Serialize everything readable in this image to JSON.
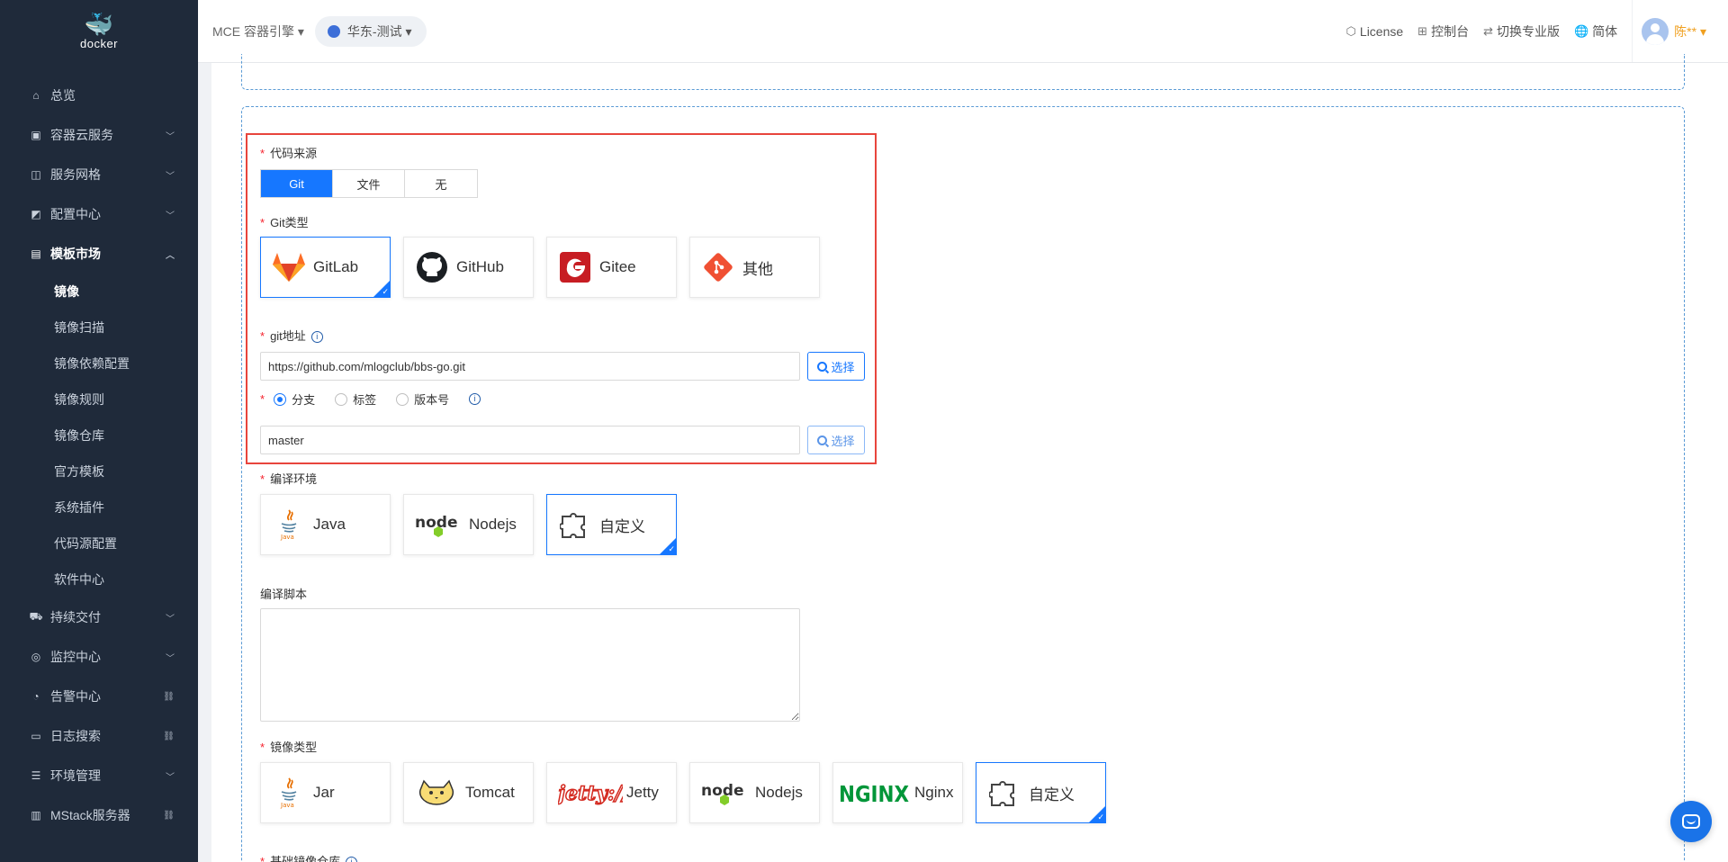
{
  "sidebar": {
    "logo_text": "docker",
    "items": [
      {
        "icon": "home-icon",
        "label": "总览",
        "arrow": ""
      },
      {
        "icon": "container-icon",
        "label": "容器云服务",
        "arrow": "⌄"
      },
      {
        "icon": "mesh-icon",
        "label": "服务网格",
        "arrow": "⌄"
      },
      {
        "icon": "config-icon",
        "label": "配置中心",
        "arrow": "⌄"
      },
      {
        "icon": "template-icon",
        "label": "模板市场",
        "arrow": "⌃"
      }
    ],
    "submenu": [
      "镜像",
      "镜像扫描",
      "镜像依赖配置",
      "镜像规则",
      "镜像仓库",
      "官方模板",
      "系统插件",
      "代码源配置",
      "软件中心"
    ],
    "items_after": [
      {
        "icon": "delivery-icon",
        "label": "持续交付",
        "arrow": "⌄"
      },
      {
        "icon": "monitor-icon",
        "label": "监控中心",
        "arrow": "⌄"
      },
      {
        "icon": "alert-icon",
        "label": "告警中心",
        "arrow": "🔗"
      },
      {
        "icon": "log-icon",
        "label": "日志搜索",
        "arrow": "🔗"
      },
      {
        "icon": "env-icon",
        "label": "环境管理",
        "arrow": "⌄"
      },
      {
        "icon": "server-icon",
        "label": "MStack服务器",
        "arrow": "🔗"
      }
    ]
  },
  "header": {
    "engine": "MCE 容器引擎 ▾",
    "region": "华东-测试 ▾",
    "license": "License",
    "console": "控制台",
    "switch_pro": "切换专业版",
    "language": "简体",
    "user": "陈** ▾"
  },
  "form": {
    "code_source_label": "代码来源",
    "code_source_options": [
      "Git",
      "文件",
      "无"
    ],
    "code_source_selected": "Git",
    "git_type_label": "Git类型",
    "git_types": [
      "GitLab",
      "GitHub",
      "Gitee",
      "其他"
    ],
    "git_type_selected": "GitLab",
    "git_address_label": "git地址",
    "git_address_value": "https://github.com/mlogclub/bbs-go.git",
    "select_button": "选择",
    "ref_options": [
      "分支",
      "标签",
      "版本号"
    ],
    "ref_selected": "分支",
    "ref_value": "master",
    "compile_env_label": "编译环境",
    "compile_envs": [
      "Java",
      "Nodejs",
      "自定义"
    ],
    "compile_env_selected": "自定义",
    "compile_script_label": "编译脚本",
    "compile_script_value": "",
    "image_type_label": "镜像类型",
    "image_types": [
      "Jar",
      "Tomcat",
      "Jetty",
      "Nodejs",
      "Nginx",
      "自定义"
    ],
    "image_type_selected": "自定义",
    "base_repo_label": "基础镜像仓库"
  },
  "colors": {
    "primary": "#1677ff",
    "sidebar_bg": "#1f2a3a",
    "highlight_red": "#e8453c",
    "required": "#f5222d"
  }
}
